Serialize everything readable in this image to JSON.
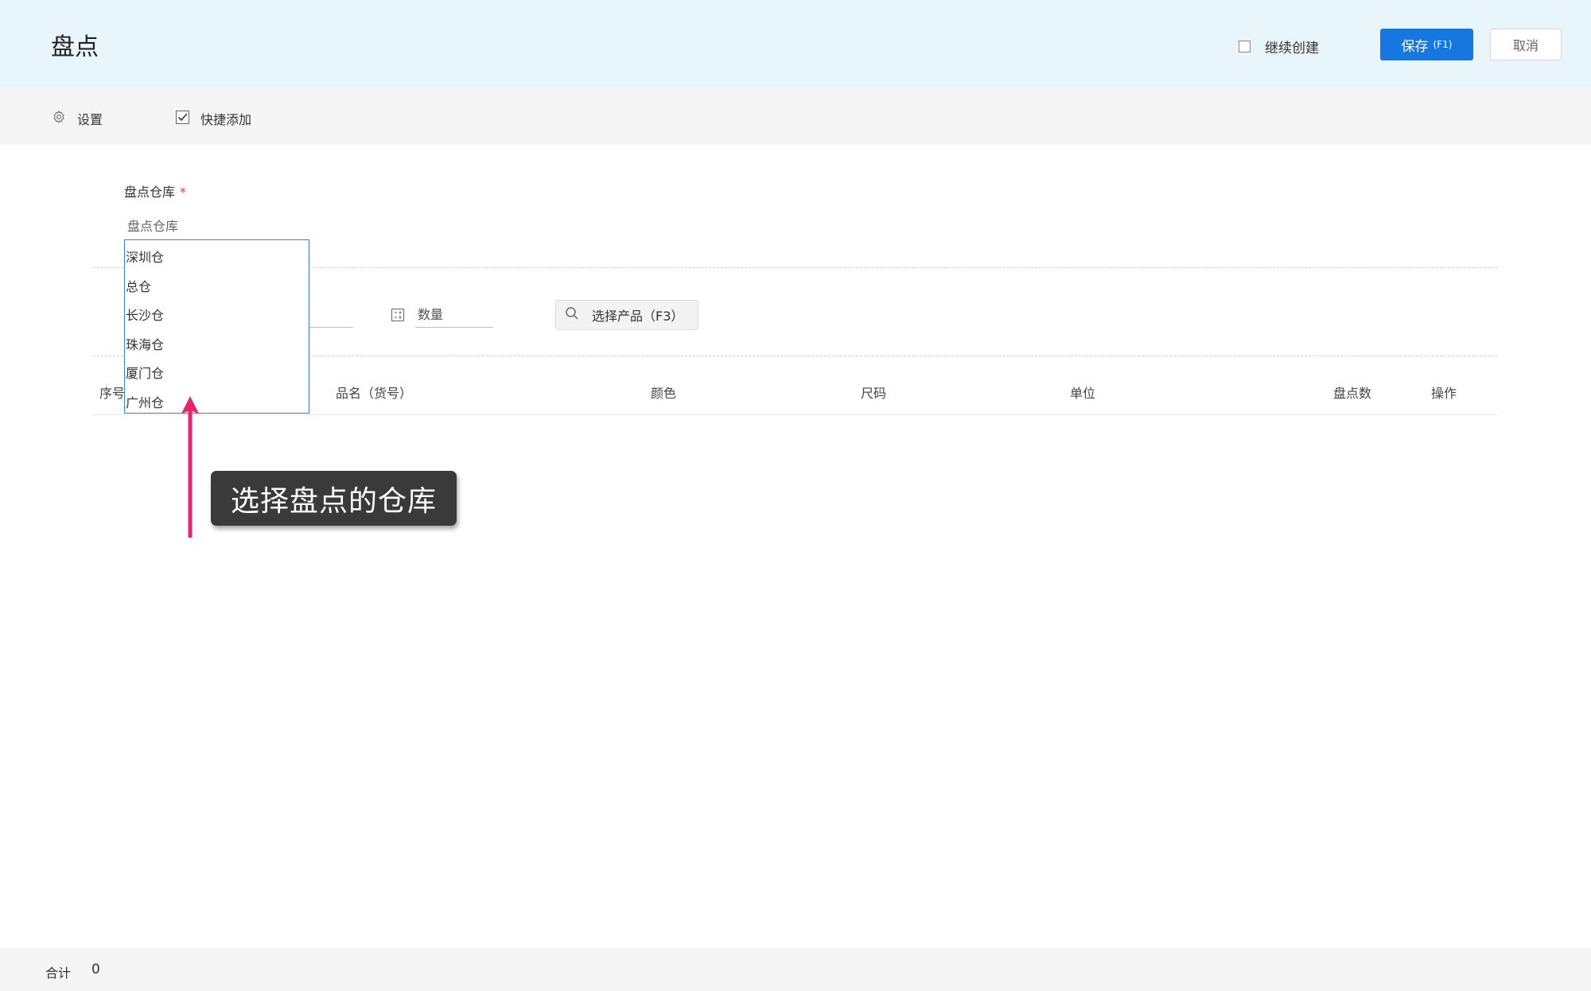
{
  "header": {
    "title": "盘点",
    "continue_create_label": "继续创建",
    "save_label": "保存",
    "save_hotkey": "(F1)",
    "cancel_label": "取消"
  },
  "toolbar": {
    "settings_label": "设置",
    "quick_add_label": "快捷添加",
    "quick_add_checked": true
  },
  "form": {
    "warehouse_label": "盘点仓库",
    "required_mark": "*",
    "warehouse_placeholder": "盘点仓库",
    "quantity_placeholder": "数量",
    "select_product_label": "选择产品（F3）"
  },
  "dropdown": {
    "options": [
      "深圳仓",
      "总仓",
      "长沙仓",
      "珠海仓",
      "厦门仓",
      "广州仓"
    ]
  },
  "table": {
    "columns": [
      "序号",
      "品名（货号）",
      "颜色",
      "尺码",
      "单位",
      "盘点数",
      "操作"
    ]
  },
  "annotation": {
    "text": "选择盘点的仓库",
    "arrow_color": "#e8246e"
  },
  "footer": {
    "total_label": "合计",
    "total_value": "0"
  },
  "colors": {
    "header_bg": "#e8f5fa",
    "primary": "#1677e0",
    "toolbar_bg": "#f5f5f5",
    "required": "#e23b3b"
  }
}
